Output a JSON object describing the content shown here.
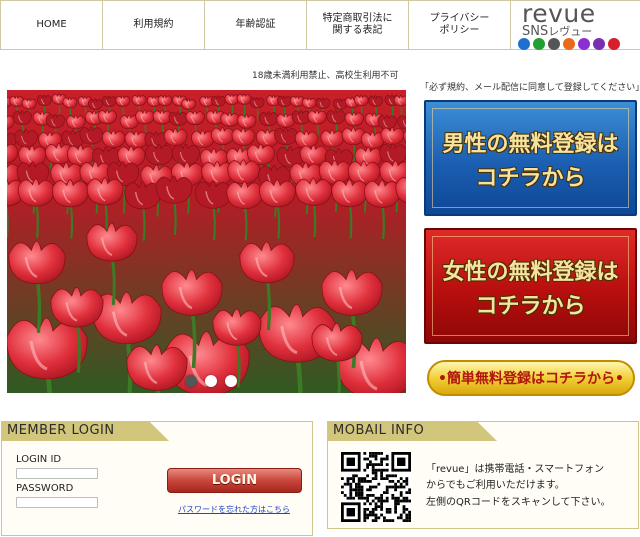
{
  "nav": {
    "items": [
      {
        "label": "HOME"
      },
      {
        "label": "利用規約"
      },
      {
        "label": "年齢認証"
      },
      {
        "line1": "特定商取引法に",
        "line2": "関する表記"
      },
      {
        "line1": "プライバシー",
        "line2": "ポリシー"
      }
    ],
    "logo": {
      "main": "revue",
      "sub_latin": "SNS",
      "sub_kana": "レヴュー"
    },
    "sns_icons": [
      {
        "name": "mail-icon",
        "color": "#1f6fd1"
      },
      {
        "name": "phone-icon",
        "color": "#1fa02f"
      },
      {
        "name": "camera-icon",
        "color": "#555555"
      },
      {
        "name": "video-icon",
        "color": "#e86a1a"
      },
      {
        "name": "chat-icon",
        "color": "#8a2fd1"
      },
      {
        "name": "search-icon",
        "color": "#7a2fb0"
      },
      {
        "name": "heart-icon",
        "color": "#d61f2a"
      }
    ]
  },
  "notice": {
    "age": "18歳未満利用禁止、高校生利用不可",
    "agree": "「必ず規約、メール配信に同意して登録してください」"
  },
  "slideshow": {
    "dots": [
      {
        "active": true
      },
      {
        "active": false
      },
      {
        "active": false
      }
    ]
  },
  "register": {
    "male": {
      "line1": "男性の無料登録は",
      "line2": "コチラから"
    },
    "female": {
      "line1": "女性の無料登録は",
      "line2": "コチラから"
    },
    "easy": "•簡単無料登録はコチラから•"
  },
  "login": {
    "title": "MEMBER LOGIN",
    "id_label": "LOGIN ID",
    "password_label": "PASSWORD",
    "button": "LOGIN",
    "forgot": "パスワードを忘れた方はこちら"
  },
  "mobile_info": {
    "title": "MOBAIL INFO",
    "line1": "「revue」は携帯電話・スマートフォン",
    "line2": "からでもご利用いただけます。",
    "line3": "左側のQRコードをスキャンして下さい。"
  }
}
